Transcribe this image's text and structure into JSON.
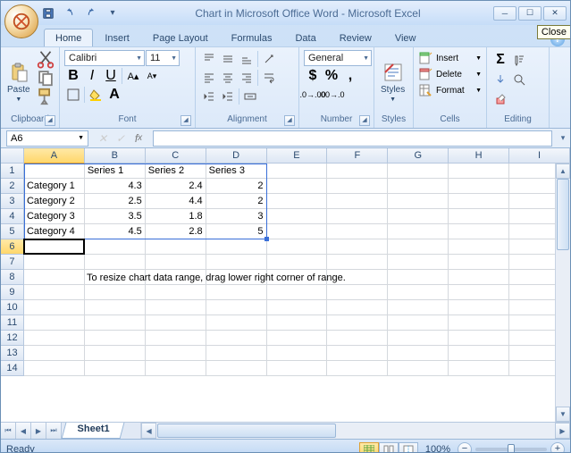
{
  "title": "Chart in Microsoft Office Word - Microsoft Excel",
  "close_tooltip": "Close",
  "tabs": [
    "Home",
    "Insert",
    "Page Layout",
    "Formulas",
    "Data",
    "Review",
    "View"
  ],
  "active_tab": 0,
  "ribbon": {
    "clipboard": {
      "label": "Clipboard",
      "paste": "Paste"
    },
    "font": {
      "label": "Font",
      "name": "Calibri",
      "size": "11"
    },
    "alignment": {
      "label": "Alignment"
    },
    "number": {
      "label": "Number",
      "format": "General"
    },
    "styles": {
      "label": "Styles",
      "btn": "Styles"
    },
    "cells": {
      "label": "Cells",
      "insert": "Insert",
      "delete": "Delete",
      "format": "Format"
    },
    "editing": {
      "label": "Editing"
    }
  },
  "namebox": "A6",
  "formula": "",
  "columns": [
    "A",
    "B",
    "C",
    "D",
    "E",
    "F",
    "G",
    "H",
    "I"
  ],
  "rows": [
    1,
    2,
    3,
    4,
    5,
    6,
    7,
    8,
    9,
    10,
    11,
    12,
    13,
    14
  ],
  "chart_data": {
    "type": "table",
    "headers": [
      "",
      "Series 1",
      "Series 2",
      "Series 3"
    ],
    "rows": [
      [
        "Category 1",
        4.3,
        2.4,
        2
      ],
      [
        "Category 2",
        2.5,
        4.4,
        2
      ],
      [
        "Category 3",
        3.5,
        1.8,
        3
      ],
      [
        "Category 4",
        4.5,
        2.8,
        5
      ]
    ]
  },
  "hint": "To resize chart data range, drag lower right corner of range.",
  "sheet": "Sheet1",
  "status": "Ready",
  "zoom": "100%"
}
